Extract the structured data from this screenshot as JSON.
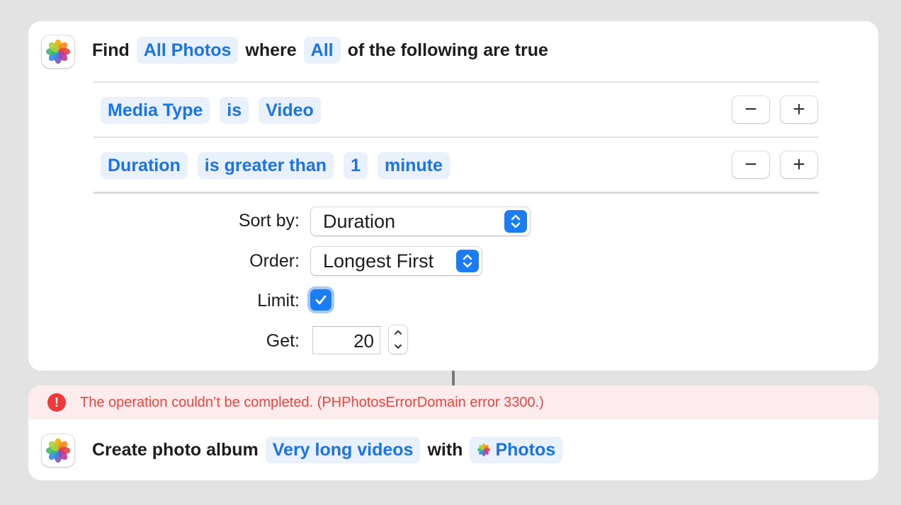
{
  "find_action": {
    "app_icon": "photos-app-icon",
    "word_find": "Find",
    "source_token": "All Photos",
    "word_where": "where",
    "match_token": "All",
    "word_following": "of the following are true",
    "conditions": [
      {
        "property": "Media Type",
        "operator": "is",
        "value": "Video",
        "minus": "−",
        "plus": "+"
      },
      {
        "property": "Duration",
        "operator": "is greater than",
        "value": "1",
        "unit": "minute",
        "minus": "−",
        "plus": "+"
      }
    ],
    "sort_by_label": "Sort by:",
    "sort_by_value": "Duration",
    "order_label": "Order:",
    "order_value": "Longest First",
    "limit_label": "Limit:",
    "limit_checked": true,
    "get_label": "Get:",
    "get_value": "20"
  },
  "error": {
    "icon": "!",
    "message": "The operation couldn’t be completed. (PHPhotosErrorDomain error 3300.)"
  },
  "create_action": {
    "app_icon": "photos-app-icon",
    "word_create": "Create photo album",
    "album_token": "Very long videos",
    "word_with": "with",
    "target_token": "Photos",
    "target_icon": "photos-mini-icon"
  },
  "colors": {
    "accent": "#1a73e8",
    "token_bg": "#e9f1fc",
    "error": "#f0443d",
    "error_bg": "#fdeced",
    "background": "#e3e3e3"
  }
}
